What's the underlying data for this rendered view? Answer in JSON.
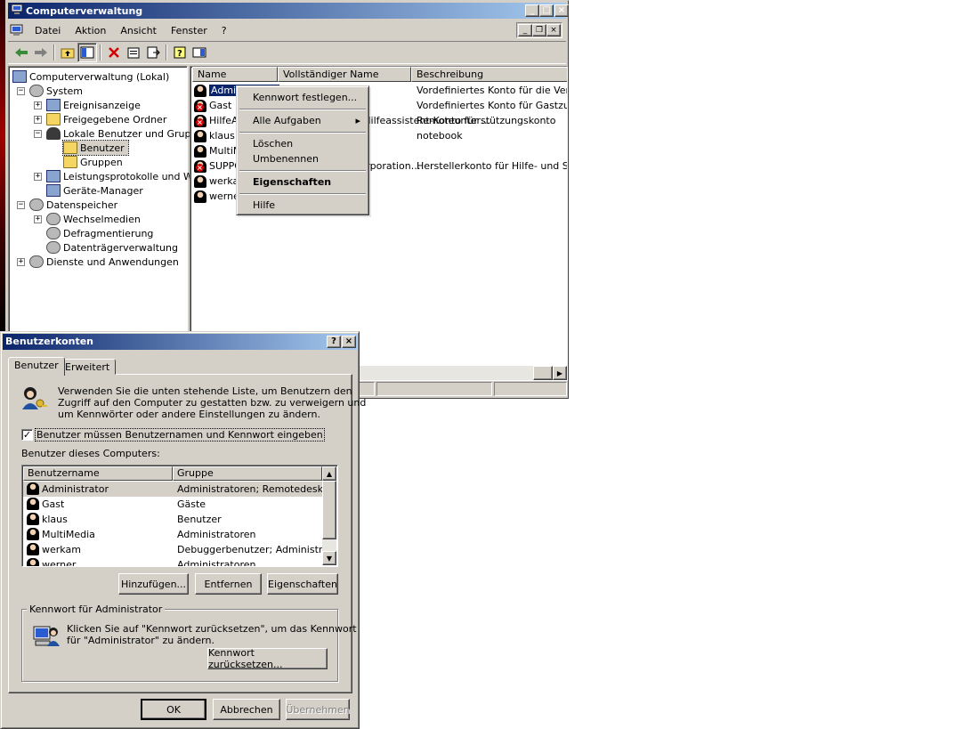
{
  "mmc": {
    "title": "Computerverwaltung",
    "menu": [
      "Datei",
      "Aktion",
      "Ansicht",
      "Fenster",
      "?"
    ],
    "caption_buttons": {
      "minimize": "_",
      "maximize": "□",
      "close": "×"
    },
    "doc_buttons": {
      "minimize": "_",
      "restore": "❐",
      "close": "×"
    },
    "toolbar_icons": [
      "back-arrow",
      "forward-arrow",
      "up-folder",
      "show-tree",
      "delete",
      "properties",
      "export-list",
      "help",
      "action-pane"
    ],
    "tree": [
      {
        "label": "Computerverwaltung (Lokal)",
        "icon": "computer",
        "expander": ""
      },
      {
        "label": "System",
        "icon": "tools",
        "expander": "−"
      },
      {
        "label": "Ereignisanzeige",
        "icon": "event-viewer",
        "expander": "+"
      },
      {
        "label": "Freigegebene Ordner",
        "icon": "shared-folder",
        "expander": "+"
      },
      {
        "label": "Lokale Benutzer und Gruppen",
        "icon": "users",
        "expander": "−"
      },
      {
        "label": "Benutzer",
        "icon": "folder-open",
        "expander": ""
      },
      {
        "label": "Gruppen",
        "icon": "folder",
        "expander": ""
      },
      {
        "label": "Leistungsprotokolle und Warnungen",
        "icon": "performance",
        "expander": "+"
      },
      {
        "label": "Geräte-Manager",
        "icon": "device-manager",
        "expander": ""
      },
      {
        "label": "Datenspeicher",
        "icon": "storage",
        "expander": "−"
      },
      {
        "label": "Wechselmedien",
        "icon": "removable-media",
        "expander": "+"
      },
      {
        "label": "Defragmentierung",
        "icon": "defrag",
        "expander": ""
      },
      {
        "label": "Datenträgerverwaltung",
        "icon": "disk-management",
        "expander": ""
      },
      {
        "label": "Dienste und Anwendungen",
        "icon": "services",
        "expander": "+"
      }
    ],
    "list_columns": [
      "Name",
      "Vollständiger Name",
      "Beschreibung"
    ],
    "list_rows": [
      {
        "name": "Administrator",
        "fullname": "",
        "description": "Vordefiniertes Konto für die Verwaltung",
        "disabled": false
      },
      {
        "name": "Gast",
        "fullname": "",
        "description": "Vordefiniertes Konto für Gastzugriff",
        "disabled": false
      },
      {
        "name": "HilfeAssistant",
        "fullname": "Remotedesktop-Hilfeassistent-Konto für …",
        "description": "Remoteunterstützungskonto",
        "disabled": true
      },
      {
        "name": "klaus",
        "fullname": "",
        "description": "notebook",
        "disabled": false
      },
      {
        "name": "MultiMedia",
        "fullname": "",
        "description": "",
        "disabled": false
      },
      {
        "name": "SUPPORT_388945a0",
        "fullname": "CN=Microsoft Corporation…",
        "description": "Herstellerkonto für Hilfe- und Supportdienst",
        "disabled": true
      },
      {
        "name": "werkam",
        "fullname": "",
        "description": "",
        "disabled": false
      },
      {
        "name": "werner",
        "fullname": "",
        "description": "",
        "disabled": false
      }
    ]
  },
  "context_menu": {
    "set_password": "Kennwort festlegen...",
    "all_tasks": "Alle Aufgaben",
    "submenu_arrow": "▸",
    "delete": "Löschen",
    "rename": "Umbenennen",
    "properties": "Eigenschaften",
    "help": "Hilfe"
  },
  "dialog": {
    "title": "Benutzerkonten",
    "help_btn": "?",
    "close_btn": "×",
    "tabs": [
      "Benutzer",
      "Erweitert"
    ],
    "intro_text_1": "Verwenden Sie die unten stehende Liste, um Benutzern den",
    "intro_text_2": "Zugriff auf den Computer zu gestatten bzw. zu verweigern und",
    "intro_text_3": "um Kennwörter oder andere Einstellungen zu ändern.",
    "checkbox_label": "Benutzer müssen Benutzernamen und Kennwort eingeben",
    "checkbox_checked": true,
    "check_mark": "✓",
    "list_label": "Benutzer dieses Computers:",
    "columns": [
      "Benutzername",
      "Gruppe"
    ],
    "users": [
      {
        "name": "Administrator",
        "group": "Administratoren; Remotedesk…"
      },
      {
        "name": "Gast",
        "group": "Gäste"
      },
      {
        "name": "klaus",
        "group": "Benutzer"
      },
      {
        "name": "MultiMedia",
        "group": "Administratoren"
      },
      {
        "name": "werkam",
        "group": "Debuggerbenutzer; Administr…"
      },
      {
        "name": "werner",
        "group": "Administratoren"
      }
    ],
    "scroll_up": "▲",
    "scroll_down": "▼",
    "add_button": "Hinzufügen...",
    "remove_button": "Entfernen",
    "properties_button": "Eigenschaften",
    "password_group_label": "Kennwort für Administrator",
    "password_text_1": "Klicken Sie auf \"Kennwort zurücksetzen\", um das Kennwort",
    "password_text_2": "für \"Administrator\" zu ändern.",
    "reset_password_button": "Kennwort zurücksetzen...",
    "ok_button": "OK",
    "cancel_button": "Abbrechen",
    "apply_button": "Übernehmen",
    "scroll_right": "▶"
  }
}
